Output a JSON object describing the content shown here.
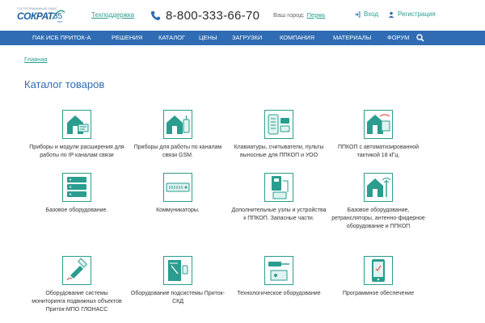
{
  "header": {
    "logo_tagline": "ГОСТЕПРИИМНЫЙ ОФИС",
    "logo_word": "СОКРАТ",
    "logo_badge": "35",
    "logo_badge_sub": "лет",
    "support": "Техподдержка",
    "phone": "8-800-333-66-70",
    "city_label": "Ваш город:",
    "city_value": "Пермь",
    "login": "Вход",
    "register": "Регистрация"
  },
  "nav": {
    "items": [
      "ПАК ИСБ ПРИТОК-А",
      "РЕШЕНИЯ",
      "КАТАЛОГ",
      "ЦЕНЫ",
      "ЗАГРУЗКИ",
      "КОМПАНИЯ",
      "МАТЕРИАЛЫ",
      "ФОРУМ"
    ]
  },
  "breadcrumb": "Главная",
  "page_title": "Каталог товаров",
  "colors": {
    "accent": "#2a9d8f",
    "nav": "#2f6cb3",
    "title": "#2f6cb3"
  },
  "catalog": [
    {
      "icon": "ip-network-device-icon",
      "label": "Приборы и модули расширения для работы по IP каналам связи"
    },
    {
      "icon": "gsm-device-icon",
      "label": "Приборы для работы по каналам связи GSM."
    },
    {
      "icon": "keypad-reader-icon",
      "label": "Клавиатуры, считыватели, пульты выносные для ППКОП и УОО"
    },
    {
      "icon": "automated-panel-icon",
      "label": "ППКОП с автоматизированной тактикой 18 кГц."
    },
    {
      "icon": "server-rack-icon",
      "label": "Базовое оборудование."
    },
    {
      "icon": "switch-icon",
      "label": "Коммуникаторы."
    },
    {
      "icon": "extension-module-icon",
      "label": "Дополнительные узлы и устройства к ППКОП. Запасные части."
    },
    {
      "icon": "repeater-station-icon",
      "label": "Базовое оборудование, ретрансляторы, антенно-фидерное оборудование и ППКОП"
    },
    {
      "icon": "gps-satellite-icon",
      "label": "Оборудование системы мониторинга подвижных объектов Приток-МПО ГЛОНАСС"
    },
    {
      "icon": "access-door-icon",
      "label": "Оборудование подсистемы Приток-СКД"
    },
    {
      "icon": "tools-equipment-icon",
      "label": "Технологическое оборудование"
    },
    {
      "icon": "software-monitor-icon",
      "label": "Программное обеспечение"
    }
  ]
}
